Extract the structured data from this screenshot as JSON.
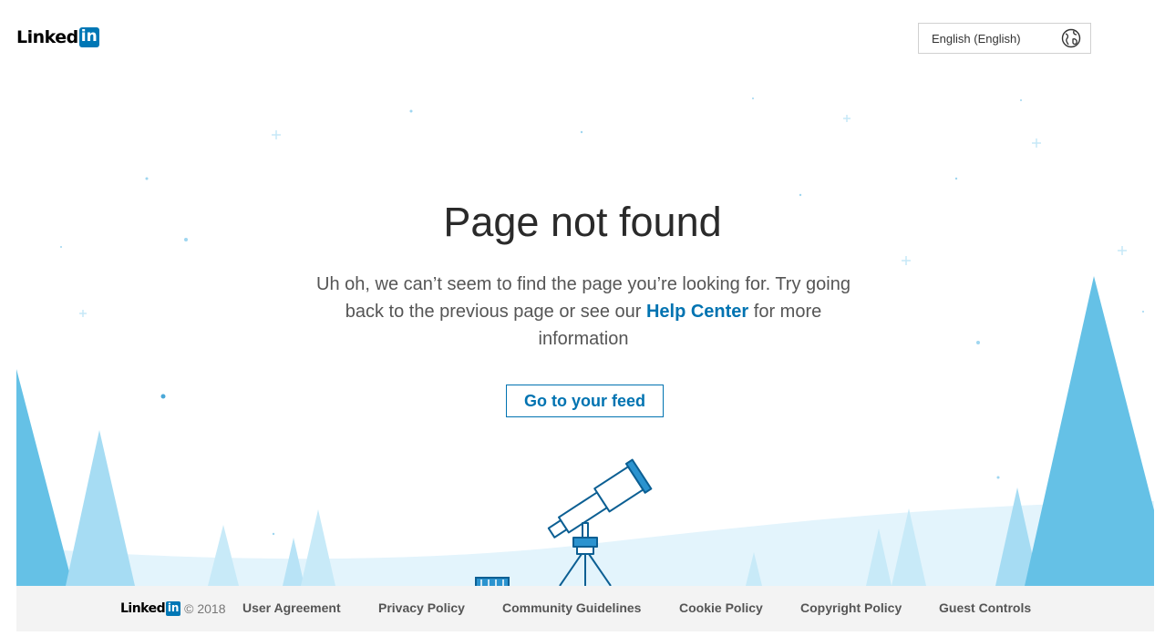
{
  "header": {
    "logo_text": "Linked",
    "logo_in": "in",
    "language": "English (English)",
    "language_icon": "globe-icon"
  },
  "main": {
    "title": "Page not found",
    "message_before": "Uh oh, we can’t seem to find the page you’re looking for. Try going back to the previous page or see our ",
    "help_link": "Help Center",
    "message_after": " for more information",
    "feed_button": "Go to your feed"
  },
  "footer": {
    "logo_text": "Linked",
    "logo_in": "in",
    "copyright": "© 2018",
    "links": [
      "User Agreement",
      "Privacy Policy",
      "Community Guidelines",
      "Cookie Policy",
      "Copyright Policy",
      "Guest Controls"
    ]
  },
  "colors": {
    "brand": "#0077b5",
    "link": "#0073b1",
    "tree_dark": "#65c1e6",
    "tree_light": "#a6dcf3",
    "snow": "#e3f4fc",
    "footer_bg": "#f3f3f3"
  }
}
